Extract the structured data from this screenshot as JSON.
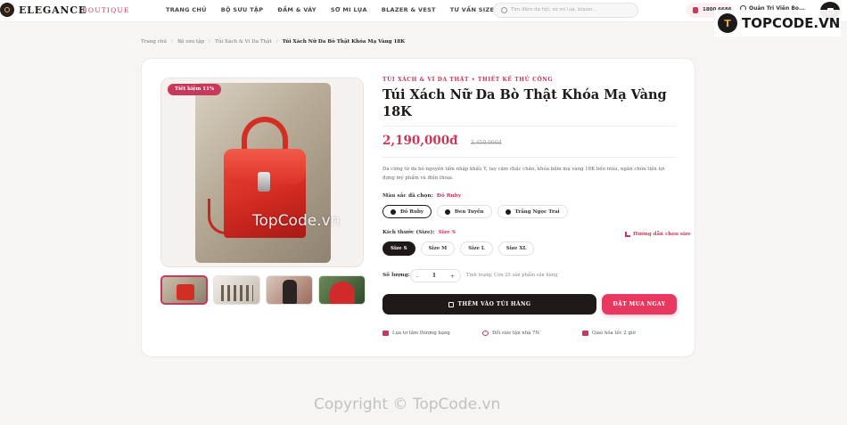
{
  "header": {
    "brand": "ELEGANCE",
    "brand_sub": "BOUTIQUE",
    "nav": [
      "TRANG CHỦ",
      "BỘ SƯU TẬP",
      "ĐẦM & VÁY",
      "SƠ MI LỤA",
      "BLAZER & VEST",
      "TƯ VẤN SIZE"
    ],
    "search_placeholder": "Tìm đầm dạ hội, sơ mi lụa, blazer...",
    "hotline": "1800 6686",
    "admin_name": "Quản Trị Viên Bo..."
  },
  "breadcrumb": [
    "Trang chủ",
    "Bộ sưu tập",
    "Túi Xách & Ví Da Thật",
    "Túi Xách Nữ Da Bò Thật Khóa Mạ Vàng 18K"
  ],
  "product": {
    "discount_badge": "Tiết kiệm 11%",
    "eyebrow": "TÚI XÁCH & VÍ DA THẬT • THIẾT KẾ THỦ CÔNG",
    "title": "Túi Xách Nữ Da Bò Thật Khóa Mạ Vàng 18K",
    "price": "2,190,000đ",
    "old_price": "2,450,000đ",
    "description": "Da cừng từ da bò nguyên tấm nhập khẩu Ý, tay cầm chắc chắn, khóa bấm mạ vàng 18K bền màu, ngăn chứa tiện lợi đựng mỹ phẩm và điện thoại.",
    "color_label": "Màu sắc đã chọn:",
    "color_selected": "Đỏ Ruby",
    "colors": [
      {
        "name": "Đỏ Ruby",
        "hex": "#1f1a17"
      },
      {
        "name": "Đen Tuyền",
        "hex": "#1f1a17"
      },
      {
        "name": "Trắng Ngọc Trai",
        "hex": "#1f1a17"
      }
    ],
    "size_label": "Kích thước (Size):",
    "size_selected": "Size S",
    "sizes": [
      "Size S",
      "Size M",
      "Size L",
      "Size XL"
    ],
    "size_guide": "Hướng dẫn chọn size",
    "qty_label": "Số lượng:",
    "qty_value": "1",
    "qty_minus": "-",
    "qty_plus": "+",
    "stock": "Tình trạng: Còn 25 sản phẩm sẵn hàng",
    "add_to_cart": "THÊM VÀO TÚI HÀNG",
    "buy_now": "ĐẶT MUA NGAY",
    "features": [
      "Lụa tơ tằm thượng hạng",
      "Đổi size tận nhà 7N",
      "Giao hỏa tốc 2 giờ"
    ]
  },
  "watermarks": {
    "image_center": "TopCode.vn",
    "bottom": "Copyright © TopCode.vn",
    "logo_text": "TOPCODE.VN"
  },
  "colors": {
    "accent": "#c8385a",
    "dark": "#1f1a17",
    "buy": "#e8385f"
  }
}
